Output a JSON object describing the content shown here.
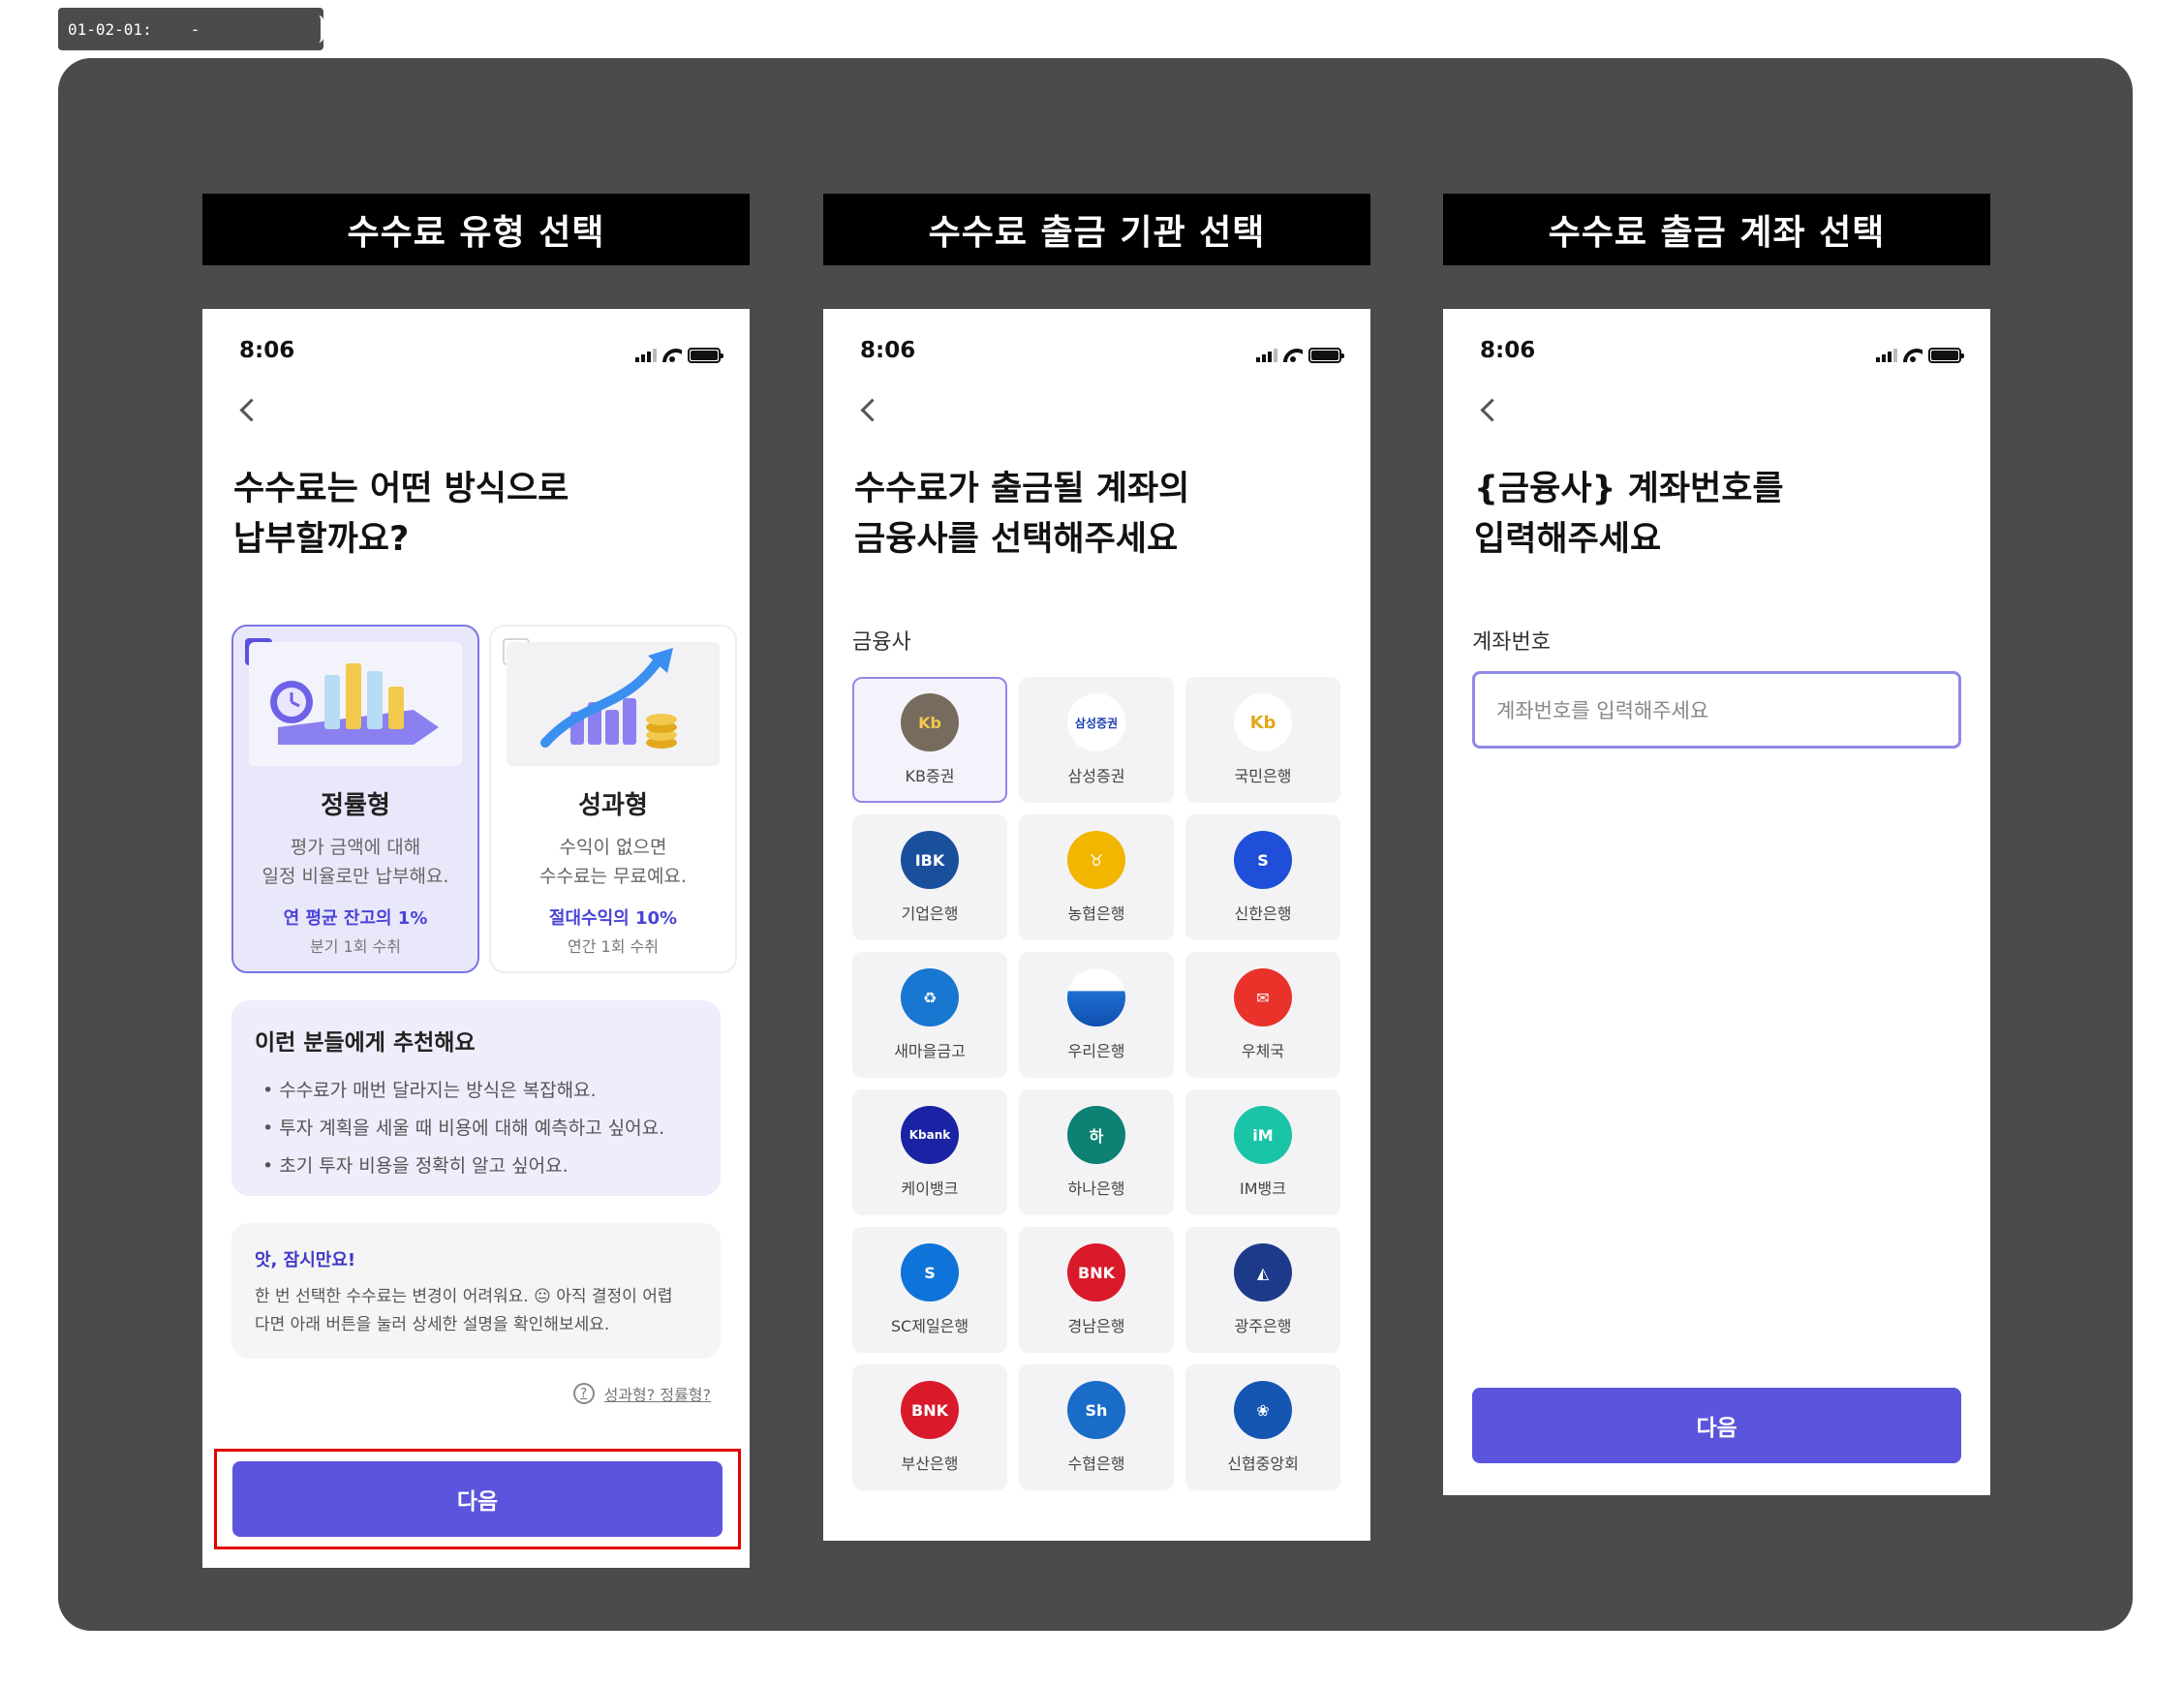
{
  "tag": {
    "label": "01-02-01:",
    "dash": "-"
  },
  "screens": [
    {
      "title": "수수료 유형 선택"
    },
    {
      "title": "수수료 출금 기관 선택"
    },
    {
      "title": "수수료 출금 계좌 선택"
    }
  ],
  "status": {
    "time": "8:06"
  },
  "screen1": {
    "headline1": "수수료는 어떤 방식으로",
    "headline2": "납부할까요?",
    "options": [
      {
        "name": "정률형",
        "desc1": "평가 금액에 대해",
        "desc2": "일정 비율로만 납부해요.",
        "highlight": "연 평균 잔고의 1%",
        "sub": "분기 1회 수취",
        "selected": true
      },
      {
        "name": "성과형",
        "desc1": "수익이 없으면",
        "desc2": "수수료는 무료예요.",
        "highlight": "절대수익의 10%",
        "sub": "연간 1회 수취",
        "selected": false
      }
    ],
    "reco_title": "이런 분들에게 추천해요",
    "reco_items": [
      "수수료가 매번 달라지는 방식은 복잡해요.",
      "투자 계획을 세울 때 비용에 대해 예측하고 싶어요.",
      "초기 투자 비용을 정확히 알고 싶어요."
    ],
    "warn_title": "앗, 잠시만요!",
    "warn_line1": "한 번 선택한 수수료는 변경이 어려워요. 😐 아직 결정이 어렵",
    "warn_line2": "다면 아래 버튼을 눌러 상세한 설명을 확인해보세요.",
    "help_icon": "?",
    "help_link": "성과형? 정률형?",
    "next": "다음"
  },
  "screen2": {
    "headline1": "수수료가 출금될 계좌의",
    "headline2": "금융사를 선택해주세요",
    "label": "금융사",
    "banks": [
      {
        "name": "KB증권",
        "icon": "kb-icon",
        "mark": "Kb",
        "color": "#776b5e",
        "selected": true
      },
      {
        "name": "삼성증권",
        "icon": "samsung-icon",
        "mark": "삼성증권",
        "color": "#ffffff",
        "selected": false
      },
      {
        "name": "국민은행",
        "icon": "kb-icon",
        "mark": "Kb",
        "color": "#ffffff",
        "selected": false
      },
      {
        "name": "기업은행",
        "icon": "ibk-icon",
        "mark": "IBK",
        "color": "#1a4f9c",
        "selected": false
      },
      {
        "name": "농협은행",
        "icon": "nh-icon",
        "mark": "♉",
        "color": "#f2b500",
        "selected": false
      },
      {
        "name": "신한은행",
        "icon": "shinhan-icon",
        "mark": "S",
        "color": "#1f4ed8",
        "selected": false
      },
      {
        "name": "새마을금고",
        "icon": "mg-icon",
        "mark": "♻",
        "color": "#1877d0",
        "selected": false
      },
      {
        "name": "우리은행",
        "icon": "woori-icon",
        "mark": "",
        "color": "#1d6fd1",
        "selected": false
      },
      {
        "name": "우체국",
        "icon": "post-icon",
        "mark": "✉",
        "color": "#e8322a",
        "selected": false
      },
      {
        "name": "케이뱅크",
        "icon": "kbank-icon",
        "mark": "Kbank",
        "color": "#1a23a3",
        "selected": false
      },
      {
        "name": "하나은행",
        "icon": "hana-icon",
        "mark": "하",
        "color": "#0d8174",
        "selected": false
      },
      {
        "name": "IM뱅크",
        "icon": "im-icon",
        "mark": "iM",
        "color": "#19c4a7",
        "selected": false
      },
      {
        "name": "SC제일은행",
        "icon": "sc-icon",
        "mark": "S",
        "color": "#0f74d9",
        "selected": false
      },
      {
        "name": "경남은행",
        "icon": "bnk-icon",
        "mark": "BNK",
        "color": "#d91a2a",
        "selected": false
      },
      {
        "name": "광주은행",
        "icon": "gwangju-icon",
        "mark": "◭",
        "color": "#1d3a8a",
        "selected": false
      },
      {
        "name": "부산은행",
        "icon": "bnk-icon",
        "mark": "BNK",
        "color": "#d91a2a",
        "selected": false
      },
      {
        "name": "수협은행",
        "icon": "suhyup-icon",
        "mark": "Sh",
        "color": "#1a6cc9",
        "selected": false
      },
      {
        "name": "신협중앙회",
        "icon": "cu-icon",
        "mark": "❀",
        "color": "#1556b3",
        "selected": false
      }
    ]
  },
  "screen3": {
    "headline1": "{금융사} 계좌번호를",
    "headline2": "입력해주세요",
    "label": "계좌번호",
    "placeholder": "계좌번호를 입력해주세요",
    "next": "다음"
  },
  "colors": {
    "accent": "#5b55de",
    "highlight_box": "#e20000",
    "board": "#4b4b4b"
  }
}
